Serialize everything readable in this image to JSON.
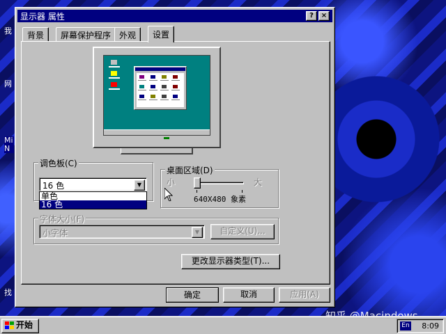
{
  "desktop": {
    "icon_labels": [
      "我",
      "网",
      "Mi\nN",
      "找"
    ],
    "watermark": "知乎 @Macindows"
  },
  "dialog": {
    "title": "显示器 属性",
    "help_glyph": "?",
    "close_glyph": "×",
    "tabs": [
      {
        "label": "背景",
        "active": false
      },
      {
        "label": "屏幕保护程序",
        "active": false
      },
      {
        "label": "外观",
        "active": false
      },
      {
        "label": "设置",
        "active": true
      }
    ],
    "palette": {
      "legend": "调色板(C)",
      "selected": "16 色",
      "options": [
        "单色",
        "16 色"
      ],
      "highlighted": "16 色"
    },
    "desktop_area": {
      "legend": "桌面区域(D)",
      "min_label": "小",
      "max_label": "大",
      "resolution": "640X480 象素",
      "slider_position": 0
    },
    "font_size": {
      "legend": "字体大小(F)",
      "selected": "小字体",
      "custom_button": "自定义(U)..."
    },
    "change_display_type_button": "更改显示器类型(T)...",
    "ok_button": "确定",
    "cancel_button": "取消",
    "apply_button": "应用(A)"
  },
  "taskbar": {
    "start_label": "开始",
    "language": "En",
    "clock": "8:09"
  }
}
